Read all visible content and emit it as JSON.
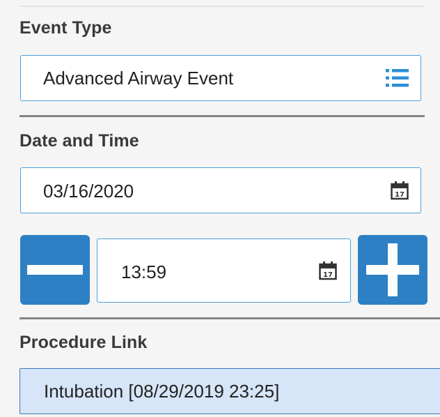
{
  "event_type": {
    "label": "Event Type",
    "value": "Advanced Airway Event",
    "icon": "list-icon"
  },
  "date_time": {
    "label": "Date and Time",
    "date_value": "03/16/2020",
    "date_icon": "calendar-icon",
    "time_value": "13:59",
    "time_icon": "calendar-icon",
    "decrement_icon": "minus-icon",
    "increment_icon": "plus-icon"
  },
  "procedure_link": {
    "label": "Procedure Link",
    "value": "Intubation [08/29/2019 23:25]"
  },
  "colors": {
    "accent": "#2d80c3",
    "field_border": "#4a9fd8",
    "selected_bg": "#d6e5f8",
    "divider": "#858585"
  }
}
